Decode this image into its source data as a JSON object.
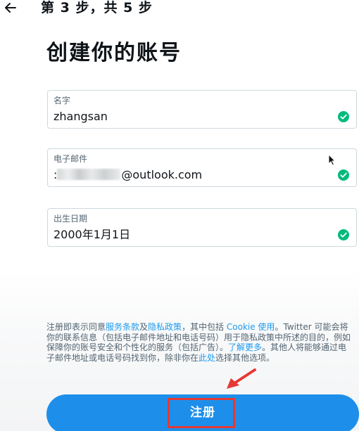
{
  "header": {
    "back_icon": "arrow-left-icon",
    "step_text": "第 3 步，共 5 步"
  },
  "page_title": "创建你的账号",
  "form": {
    "name_field": {
      "label": "名字",
      "value": "zhangsan",
      "status_icon": "check-circle-icon"
    },
    "email_field": {
      "label": "电子邮件",
      "value_prefix": ":",
      "value_suffix": "@outlook.com",
      "status_icon": "check-circle-icon"
    },
    "dob_field": {
      "label": "出生日期",
      "value": "2000年1月1日",
      "status_icon": "check-circle-icon"
    }
  },
  "terms": {
    "t1": "注册即表示同意",
    "link_terms": "服务条款",
    "t2": "及",
    "link_privacy": "隐私政策",
    "t3": "，其中包括 ",
    "link_cookie": "Cookie 使用",
    "t4": "。Twitter 可能会将你的联系信息（包括电子邮件地址和电话号码）用于隐私政策中所述的目的，例如保障你的账号安全和个性化的服务（包括广告）。",
    "link_learn_more": "了解更多",
    "t5": "。其他人将能够通过电子邮件地址或电话号码找到你，除非你在",
    "link_here": "此处",
    "t6": "选择其他选项。"
  },
  "signup_button": {
    "label": "注册"
  },
  "colors": {
    "accent": "#1d9bf0",
    "button": "#1d8fea",
    "check": "#00ba7c",
    "annotation": "#e53935",
    "text": "#0f1419",
    "muted": "#536471"
  },
  "annotation": {
    "highlight": "signup-button",
    "arrow_icon": "red-arrow-icon"
  }
}
